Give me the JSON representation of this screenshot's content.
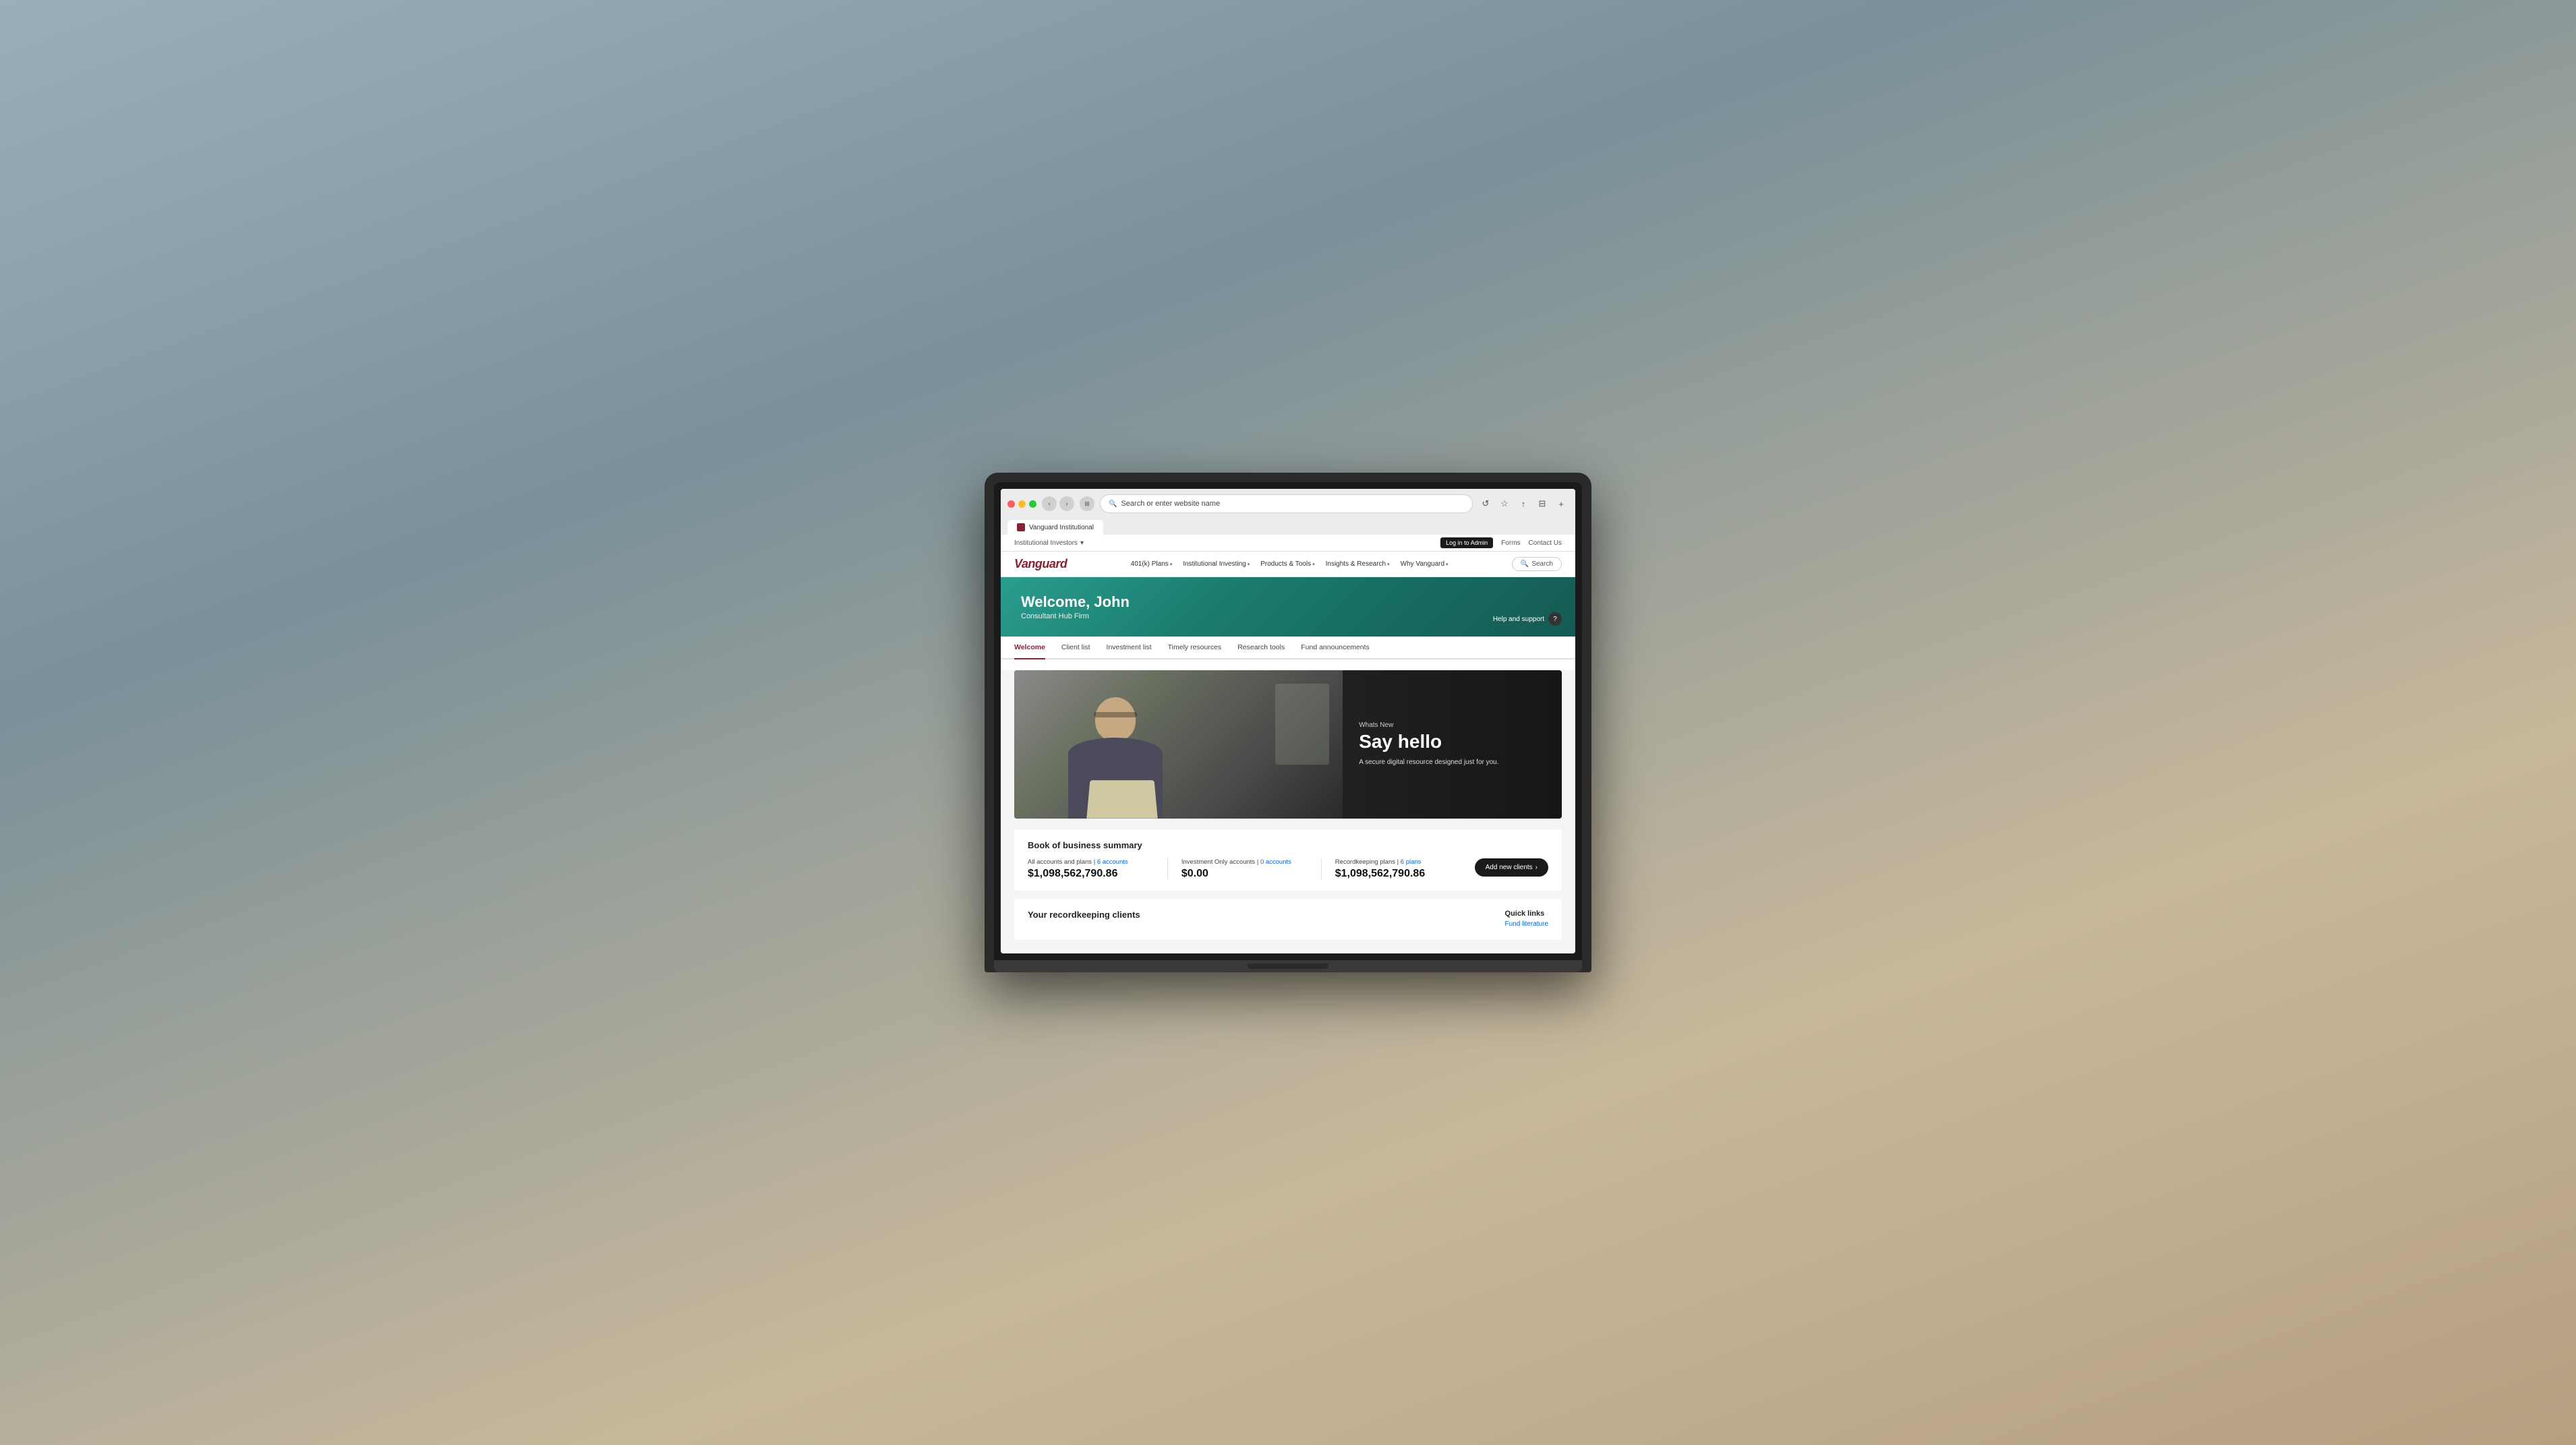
{
  "browser": {
    "address": "Search or enter website name",
    "tab_title": "Vanguard Institutional",
    "tab_favicon_alt": "vanguard-favicon"
  },
  "topbar": {
    "audience_selector": "Institutional Investors",
    "chevron": "▾",
    "login_btn": "Log in to Admin",
    "links": [
      "Forms",
      "Contact Us"
    ]
  },
  "mainnav": {
    "logo": "Vanguard",
    "links": [
      {
        "label": "401(k) Plans",
        "has_dropdown": true
      },
      {
        "label": "Institutional Investing",
        "has_dropdown": true
      },
      {
        "label": "Products & Tools",
        "has_dropdown": true
      },
      {
        "label": "Insights & Research",
        "has_dropdown": true
      },
      {
        "label": "Why Vanguard",
        "has_dropdown": true
      }
    ],
    "search_btn": "Search"
  },
  "hero": {
    "welcome_title": "Welcome, John",
    "firm_name": "Consultant Hub Firm",
    "help_label": "Help and support"
  },
  "page_tabs": [
    {
      "label": "Welcome",
      "active": true
    },
    {
      "label": "Client list",
      "active": false
    },
    {
      "label": "Investment list",
      "active": false
    },
    {
      "label": "Timely resources",
      "active": false
    },
    {
      "label": "Research tools",
      "active": false
    },
    {
      "label": "Fund announcements",
      "active": false
    }
  ],
  "hero_card": {
    "whats_new": "Whats New",
    "title": "Say hello",
    "description": "A secure digital resource designed just for you."
  },
  "summary": {
    "section_title": "Book of business summary",
    "add_btn": "Add new clients",
    "items": [
      {
        "label": "All accounts and plans",
        "link_text": "6 accounts",
        "value": "$1,098,562,790.86"
      },
      {
        "label": "Investment Only accounts",
        "link_text": "0 accounts",
        "value": "$0.00"
      },
      {
        "label": "Recordkeeping plans",
        "link_text": "6 plans",
        "value": "$1,098,562,790.86"
      }
    ]
  },
  "recordkeeping": {
    "section_title": "Your recordkeeping clients",
    "quick_links_title": "Quick links",
    "quick_links": [
      {
        "label": "Fund literature"
      }
    ]
  },
  "icons": {
    "search": "🔍",
    "back": "‹",
    "forward": "›",
    "tab_view": "⊞",
    "refresh": "↺",
    "bookmark": "☆",
    "share": "↑",
    "sidebar": "⊟",
    "new_tab": "+",
    "chevron_down": "▾",
    "help_icon": "?",
    "arrow_right": "›"
  }
}
